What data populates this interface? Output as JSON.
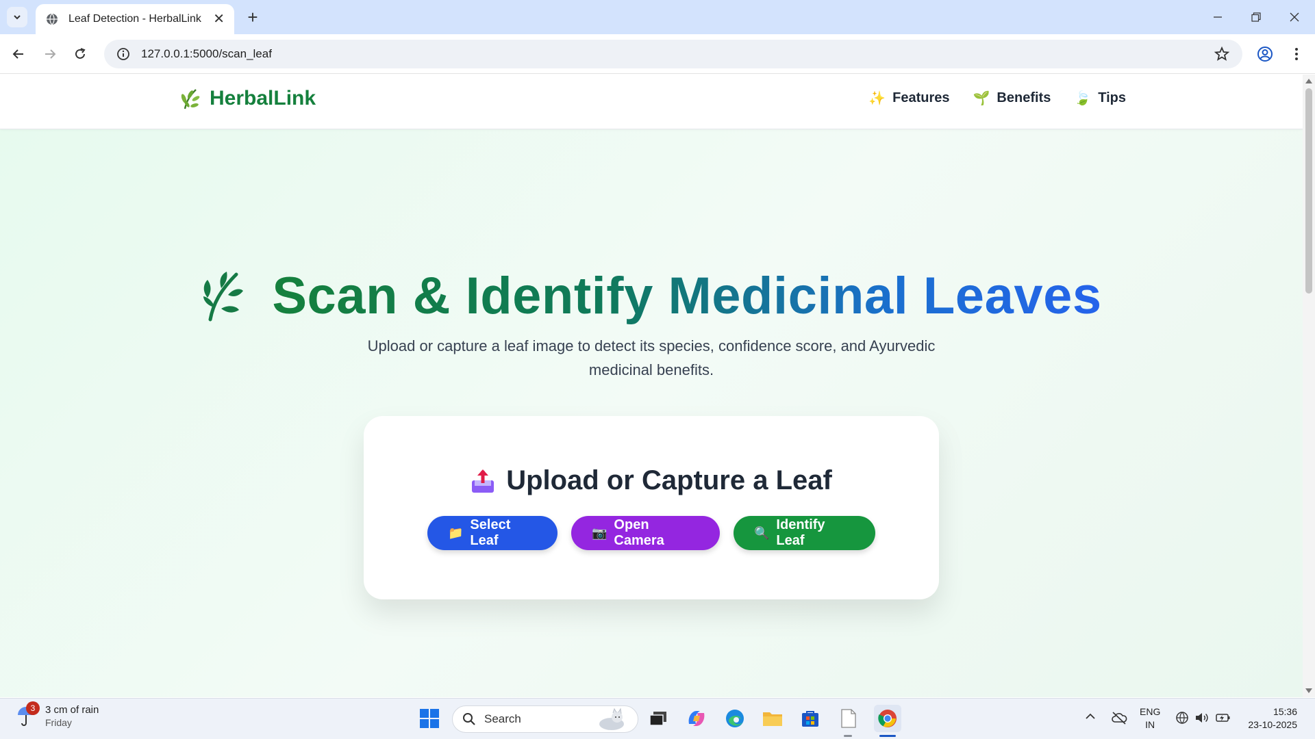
{
  "browser": {
    "tab_title": "Leaf Detection - HerbalLink",
    "url": "127.0.0.1:5000/scan_leaf"
  },
  "site": {
    "brand": "HerbalLink",
    "nav": [
      {
        "emoji": "✨",
        "label": "Features"
      },
      {
        "emoji": "🌱",
        "label": "Benefits"
      },
      {
        "emoji": "🍃",
        "label": "Tips"
      }
    ]
  },
  "hero": {
    "title": "Scan & Identify Medicinal Leaves",
    "subtitle": "Upload or capture a leaf image to detect its species, confidence score, and Ayurvedic medicinal benefits."
  },
  "upload_card": {
    "title": "Upload or Capture a Leaf",
    "buttons": [
      {
        "emoji": "📁",
        "label": "Select Leaf",
        "color": "#2457e6"
      },
      {
        "emoji": "📷",
        "label": "Open Camera",
        "color": "#9426e0"
      },
      {
        "emoji": "🔍",
        "label": "Identify Leaf",
        "color": "#16963e"
      }
    ]
  },
  "taskbar": {
    "weather_badge": "3",
    "weather_line1": "3 cm of rain",
    "weather_line2": "Friday",
    "search_label": "Search",
    "lang_line1": "ENG",
    "lang_line2": "IN",
    "time": "15:36",
    "date": "23-10-2025"
  },
  "colors": {
    "brand_green": "#15803d",
    "title_gradient_end": "#2563eb"
  }
}
